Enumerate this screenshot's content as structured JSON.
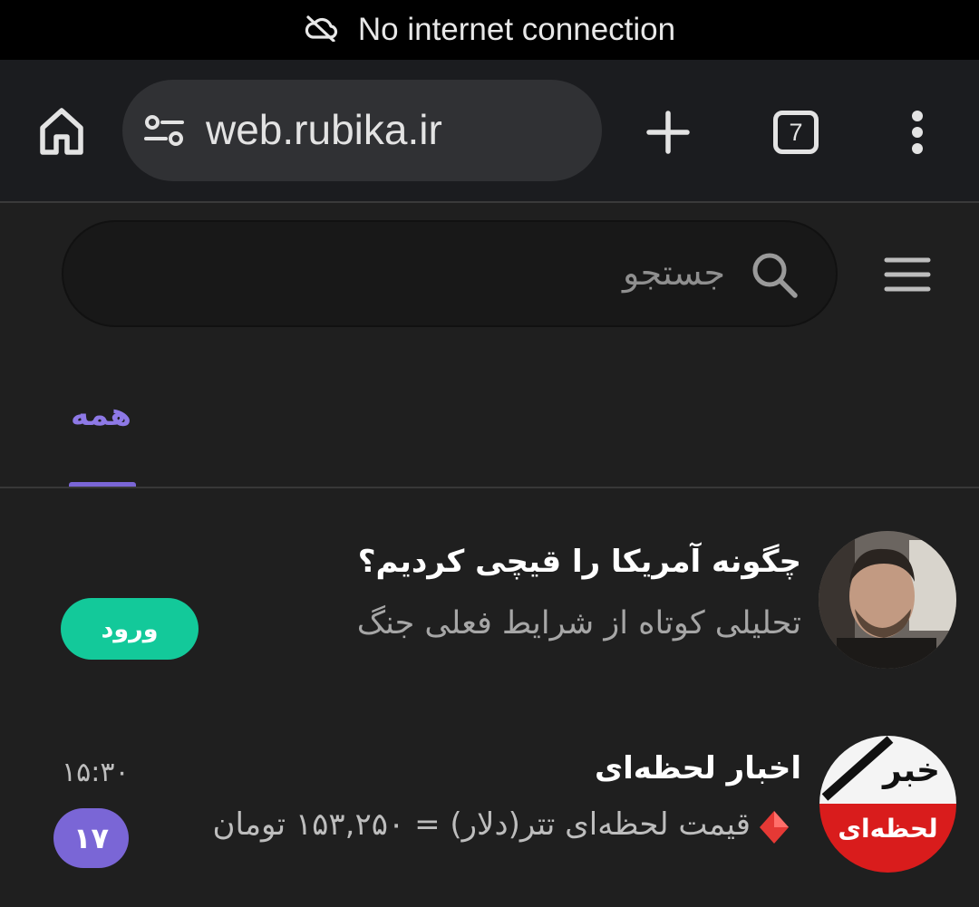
{
  "status_bar": {
    "message": "No internet connection",
    "icon": "cloud-off-icon"
  },
  "browser": {
    "url": "web.rubika.ir",
    "tab_count": "7",
    "icons": {
      "home": "home-icon",
      "site_info": "tune-icon",
      "new_tab": "plus-icon",
      "tabs": "tabs-icon",
      "menu": "more-vert-icon"
    }
  },
  "app": {
    "search_placeholder": "جستجو",
    "tabs": [
      {
        "label": "همه",
        "selected": true
      }
    ],
    "accent_color": "#7a66d6",
    "green_color": "#13c99a"
  },
  "chats": [
    {
      "title": "چگونه آمریکا را قیچی کردیم؟",
      "subtitle": "تحلیلی کوتاه از شرایط فعلی جنگ",
      "action_label": "ورود"
    },
    {
      "title": "اخبار لحظه‌ای",
      "preview": "قیمت لحظه‌ای تتر(دلار) = ۱۵۳,۲۵۰ تومان",
      "time": "۱۵:۳۰",
      "unread": "۱۷",
      "avatar_text_top": "خبر",
      "avatar_text_bottom": "لحظه‌ای"
    }
  ]
}
